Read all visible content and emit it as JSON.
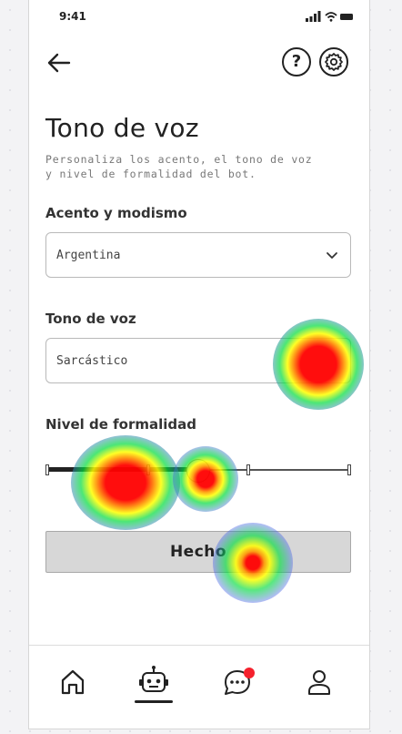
{
  "status_bar": {
    "time": "9:41"
  },
  "header": {
    "back_icon": "arrow-left-icon",
    "help_label": "?",
    "settings_icon": "gear-icon"
  },
  "page": {
    "title": "Tono de voz",
    "subtitle": "Personaliza los acento, el tono de voz y nivel de formalidad del bot."
  },
  "accent": {
    "label": "Acento y modismo",
    "value": "Argentina"
  },
  "tone": {
    "label": "Tono de voz",
    "value": "Sarcástico"
  },
  "formality": {
    "label": "Nivel de formalidad",
    "level_fraction": 0.5,
    "steps": 4
  },
  "done_button": {
    "label": "Hecho"
  },
  "tabbar": {
    "items": [
      "home-icon",
      "bot-icon",
      "chat-icon",
      "user-icon"
    ],
    "active": 1,
    "chat_badge_color": "#f5212d"
  },
  "colors": {
    "accent": "#222222",
    "notification": "#f5212d"
  }
}
